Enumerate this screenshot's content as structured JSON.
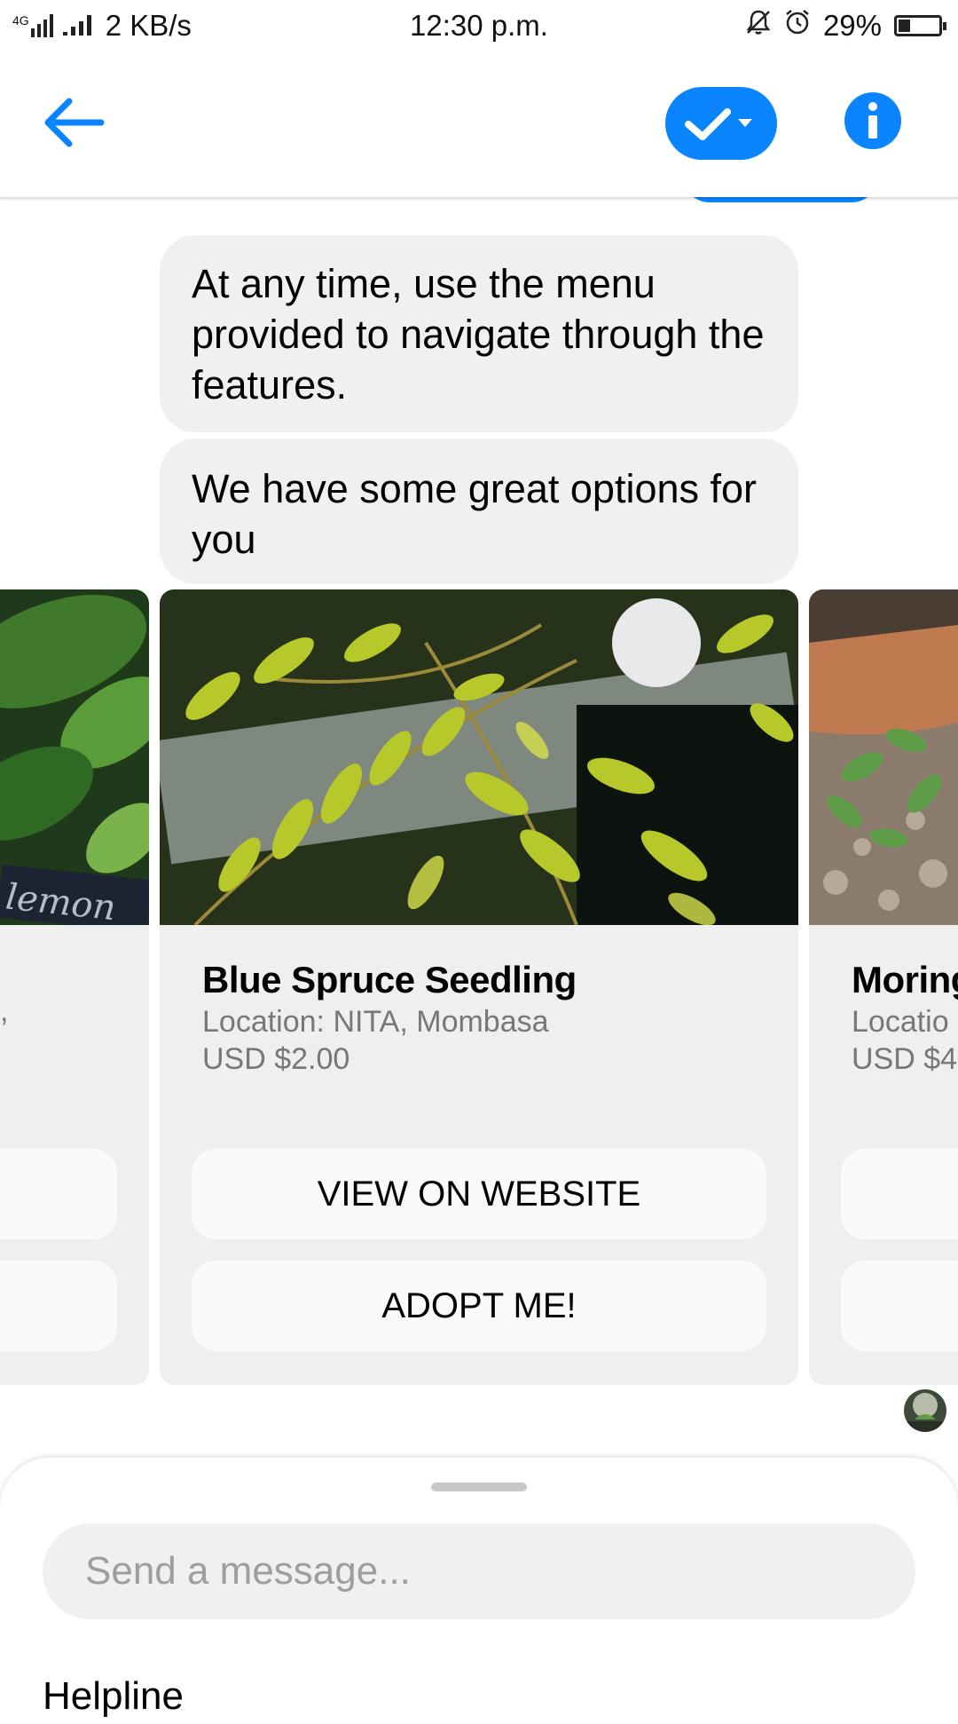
{
  "status_bar": {
    "network_label": "4G",
    "speed": "2 KB/s",
    "time": "12:30 p.m.",
    "battery_percent": "29%",
    "battery_level": 0.29,
    "icons": [
      "signal-icon",
      "signal-icon",
      "bell-muted-icon",
      "alarm-icon",
      "battery-icon"
    ]
  },
  "top_bar": {
    "icons": [
      "back-arrow-icon",
      "checkmark-dropdown-icon",
      "info-icon"
    ],
    "accent_color": "#0a84ff"
  },
  "messages": [
    {
      "text": "At any time, use the menu provided to navigate through the features."
    },
    {
      "text": "We have some great options for you"
    }
  ],
  "carousel": {
    "main_card": {
      "title": "Blue Spruce Seedling",
      "location": "Location: NITA, Mombasa",
      "price": "USD $2.00",
      "buttons": [
        "VIEW ON WEBSITE",
        "ADOPT ME!"
      ]
    },
    "left_card": {
      "image_label": "lemon",
      "text_fragment": ","
    },
    "right_card": {
      "title_fragment": "Moring",
      "location_fragment": "Locatio",
      "price_fragment": "USD $4"
    }
  },
  "composer": {
    "placeholder": "Send a message...",
    "value": ""
  },
  "menu": {
    "first_item": "Helpline"
  }
}
